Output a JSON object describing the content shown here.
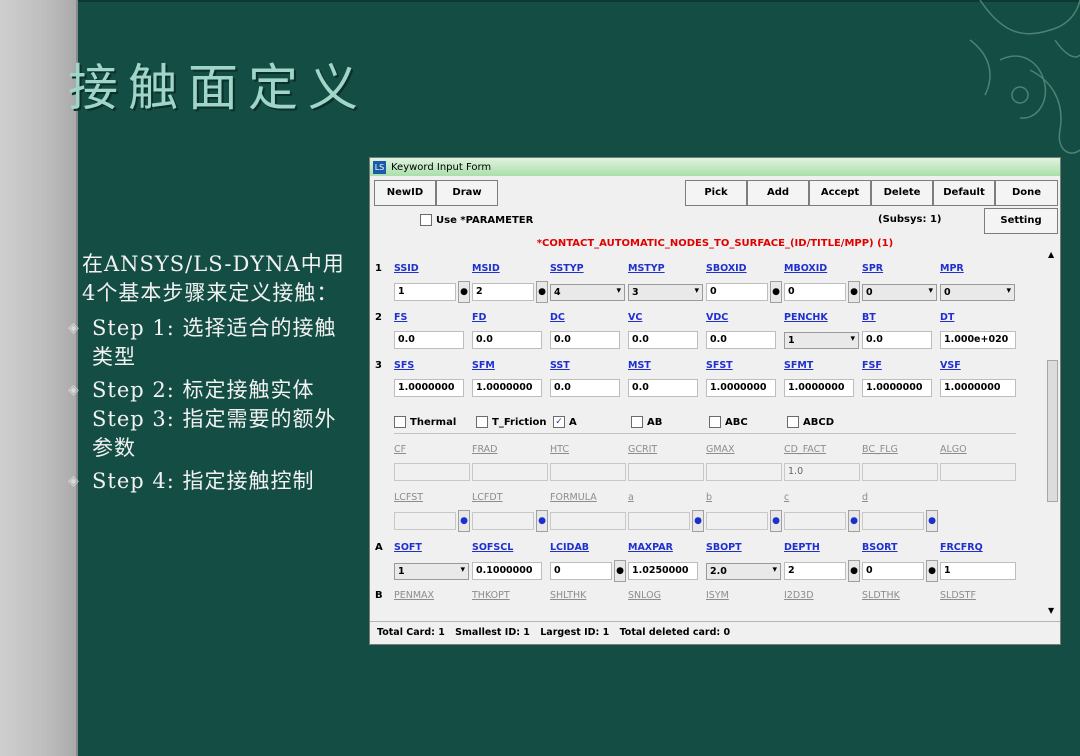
{
  "slide": {
    "title": "接触面定义",
    "intro": "在ANSYS/LS-DYNA中用4个基本步骤来定义接触：",
    "steps": [
      "Step 1: 选择适合的接触类型",
      "Step 2: 标定接触实体",
      "Step 3: 指定需要的额外参数",
      "Step 4: 指定接触控制"
    ]
  },
  "window": {
    "title": "Keyword Input Form",
    "buttons_left": [
      "NewID",
      "Draw"
    ],
    "buttons_right": [
      "Pick",
      "Add",
      "Accept",
      "Delete",
      "Default",
      "Done"
    ],
    "use_parameter": "Use *PARAMETER",
    "subsys": "(Subsys: 1)",
    "setting": "Setting",
    "keyword": "*CONTACT_AUTOMATIC_NODES_TO_SURFACE_(ID/TITLE/MPP)  (1)",
    "row_labels": [
      "1",
      "2",
      "3",
      "A",
      "B"
    ],
    "card1": {
      "labels": [
        "SSID",
        "MSID",
        "SSTYP",
        "MSTYP",
        "SBOXID",
        "MBOXID",
        "SPR",
        "MPR"
      ],
      "values": [
        "1",
        "2",
        "4",
        "3",
        "0",
        "0",
        "0",
        "0"
      ]
    },
    "card2": {
      "labels": [
        "FS",
        "FD",
        "DC",
        "VC",
        "VDC",
        "PENCHK",
        "BT",
        "DT"
      ],
      "values": [
        "0.0",
        "0.0",
        "0.0",
        "0.0",
        "0.0",
        "1",
        "0.0",
        "1.000e+020"
      ]
    },
    "card3": {
      "labels": [
        "SFS",
        "SFM",
        "SST",
        "MST",
        "SFST",
        "SFMT",
        "FSF",
        "VSF"
      ],
      "values": [
        "1.0000000",
        "1.0000000",
        "0.0",
        "0.0",
        "1.0000000",
        "1.0000000",
        "1.0000000",
        "1.0000000"
      ]
    },
    "options": [
      {
        "label": "Thermal",
        "checked": false
      },
      {
        "label": "T_Friction",
        "checked": false
      },
      {
        "label": "A",
        "checked": true
      },
      {
        "label": "AB",
        "checked": false
      },
      {
        "label": "ABC",
        "checked": false
      },
      {
        "label": "ABCD",
        "checked": false
      }
    ],
    "thermal1": {
      "labels": [
        "CF",
        "FRAD",
        "HTC",
        "GCRIT",
        "GMAX",
        "CD_FACT",
        "BC_FLG",
        "ALGO"
      ],
      "values": [
        "",
        "",
        "",
        "",
        "",
        "1.0",
        "",
        ""
      ]
    },
    "thermal2": {
      "labels": [
        "LCFST",
        "LCFDT",
        "FORMULA",
        "a",
        "b",
        "c",
        "d"
      ]
    },
    "cardA": {
      "labels": [
        "SOFT",
        "SOFSCL",
        "LCIDAB",
        "MAXPAR",
        "SBOPT",
        "DEPTH",
        "BSORT",
        "FRCFRQ"
      ],
      "values": [
        "1",
        "0.1000000",
        "0",
        "1.0250000",
        "2.0",
        "2",
        "0",
        "1"
      ]
    },
    "cardB": {
      "labels": [
        "PENMAX",
        "THKOPT",
        "SHLTHK",
        "SNLOG",
        "ISYM",
        "I2D3D",
        "SLDTHK",
        "SLDSTF"
      ]
    },
    "status": {
      "total_card": "Total Card: 1",
      "smallest_id": "Smallest ID: 1",
      "largest_id": "Largest ID: 1",
      "total_deleted": "Total deleted card: 0"
    }
  }
}
